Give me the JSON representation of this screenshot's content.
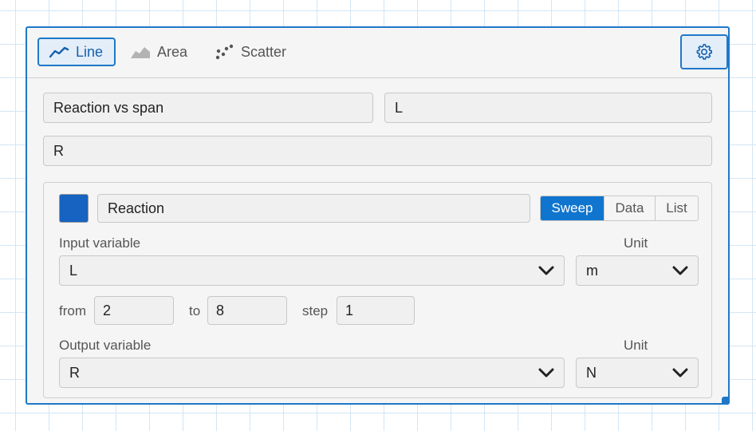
{
  "tabs": {
    "line": "Line",
    "area": "Area",
    "scatter": "Scatter",
    "active": "line"
  },
  "settings": {
    "icon": "gear-icon"
  },
  "chart": {
    "title": "Reaction vs span",
    "x_label": "L",
    "y_label": "R"
  },
  "series": {
    "color": "#1663c2",
    "name": "Reaction",
    "mode_tabs": [
      "Sweep",
      "Data",
      "List"
    ],
    "active_mode": "Sweep",
    "input_label": "Input variable",
    "input_unit_label": "Unit",
    "input_variable": "L",
    "input_unit": "m",
    "from_label": "from",
    "from_value": "2",
    "to_label": "to",
    "to_value": "8",
    "step_label": "step",
    "step_value": "1",
    "output_label": "Output variable",
    "output_unit_label": "Unit",
    "output_variable": "R",
    "output_unit": "N"
  },
  "colors": {
    "accent": "#1f78c8",
    "active_seg": "#0f75cf"
  }
}
